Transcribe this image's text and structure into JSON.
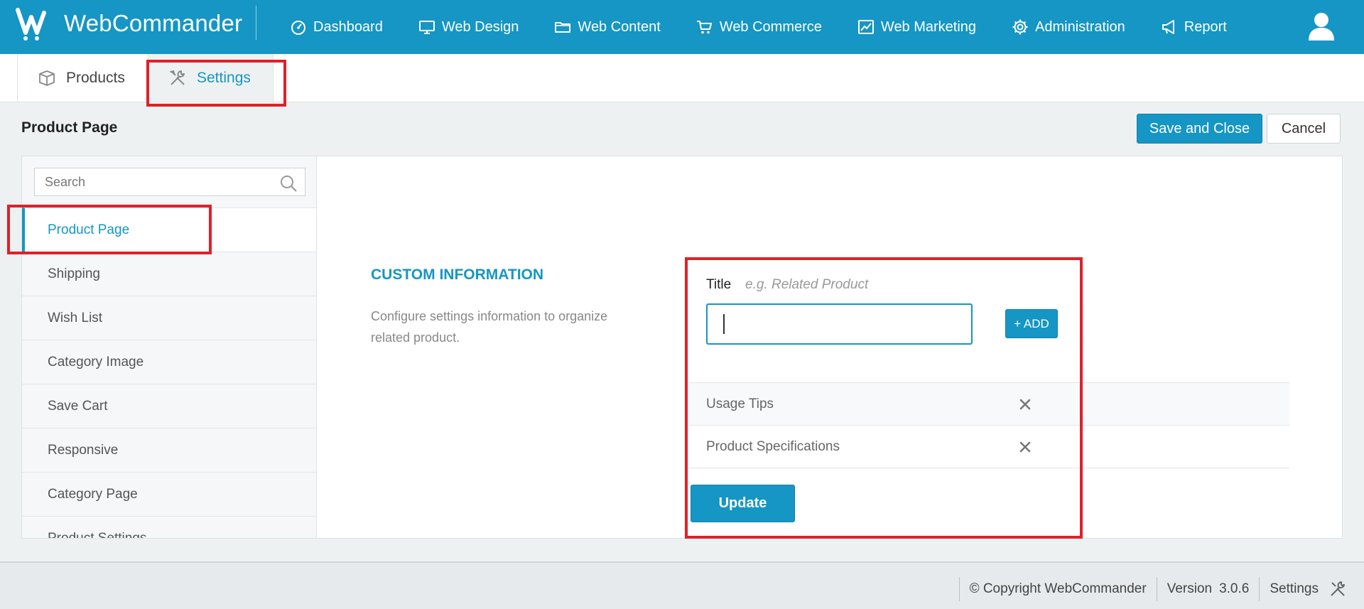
{
  "app": {
    "brand": "WebCommander",
    "accent_color": "#1596c4",
    "highlight_color": "#e0202a"
  },
  "nav": {
    "items": [
      {
        "label": "Dashboard",
        "icon": "dashboard-gauge-icon"
      },
      {
        "label": "Web Design",
        "icon": "monitor-icon"
      },
      {
        "label": "Web Content",
        "icon": "folder-icon"
      },
      {
        "label": "Web Commerce",
        "icon": "cart-icon"
      },
      {
        "label": "Web Marketing",
        "icon": "chart-image-icon"
      },
      {
        "label": "Administration",
        "icon": "gear-icon"
      },
      {
        "label": "Report",
        "icon": "megaphone-icon"
      }
    ],
    "user_icon": "user-icon"
  },
  "tabs": [
    {
      "label": "Products",
      "icon": "box-icon"
    },
    {
      "label": "Settings",
      "icon": "tools-icon",
      "active": true
    }
  ],
  "header": {
    "title": "Product Page",
    "save_close_label": "Save and Close",
    "cancel_label": "Cancel"
  },
  "sidebar": {
    "search_placeholder": "Search",
    "items": [
      {
        "label": "Product Page",
        "active": true
      },
      {
        "label": "Shipping"
      },
      {
        "label": "Wish List"
      },
      {
        "label": "Category Image"
      },
      {
        "label": "Save Cart"
      },
      {
        "label": "Responsive"
      },
      {
        "label": "Category Page"
      },
      {
        "label": "Product Settings"
      }
    ]
  },
  "custom_info": {
    "title": "CUSTOM INFORMATION",
    "description": "Configure settings information to organize related product.",
    "field_label": "Title",
    "field_hint": "e.g. Related Product",
    "field_value": "",
    "add_label": "+ ADD",
    "entries": [
      "Usage Tips",
      "Product Specifications"
    ],
    "update_label": "Update"
  },
  "footer": {
    "copyright": "© Copyright WebCommander",
    "version_label": "Version",
    "version_number": "3.0.6",
    "settings_label": "Settings"
  }
}
